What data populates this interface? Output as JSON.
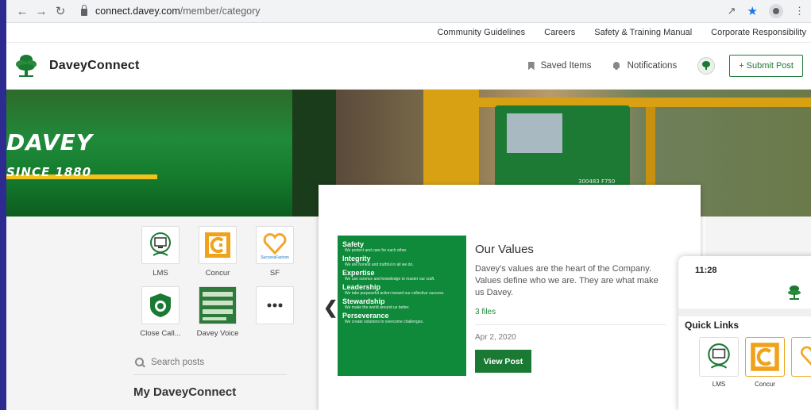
{
  "browser": {
    "url_host": "connect.davey.com",
    "url_path": "/member/category"
  },
  "utility_links": [
    "Community Guidelines",
    "Careers",
    "Safety & Training Manual",
    "Corporate Responsibility"
  ],
  "header": {
    "site_name": "DaveyConnect",
    "saved_items": "Saved Items",
    "notifications": "Notifications",
    "submit_post": "+ Submit Post"
  },
  "hero": {
    "brand": "DAVEY",
    "since": "SINCE 1880",
    "truck_tag": "300483 F750"
  },
  "apps": [
    {
      "label": "LMS",
      "icon": "lms-icon"
    },
    {
      "label": "Concur",
      "icon": "concur-icon"
    },
    {
      "label": "SF",
      "icon": "successfactors-icon"
    },
    {
      "label": "Close Call...",
      "icon": "close-call-icon"
    },
    {
      "label": "Davey Voice",
      "icon": "davey-voice-icon"
    },
    {
      "label": "",
      "icon": "more-icon"
    }
  ],
  "search": {
    "placeholder": "Search posts"
  },
  "my_section_title": "My DaveyConnect",
  "values_image": [
    {
      "head": "Safety",
      "sub": "We protect and care for each other."
    },
    {
      "head": "Integrity",
      "sub": "We are honest and truthful in all we do."
    },
    {
      "head": "Expertise",
      "sub": "We use science and knowledge to master our craft."
    },
    {
      "head": "Leadership",
      "sub": "We take purposeful action toward our collective success."
    },
    {
      "head": "Stewardship",
      "sub": "We make the world around us better."
    },
    {
      "head": "Perseverance",
      "sub": "We create solutions to overcome challenges."
    }
  ],
  "post": {
    "title": "Our Values",
    "description": "Davey's values are the heart of the Company. Values define who we are. They are what make us Davey.",
    "files": "3 files",
    "date": "Apr 2, 2020",
    "view_button": "View Post"
  },
  "phone": {
    "time": "11:28",
    "quick_links_title": "Quick Links",
    "apps": [
      "LMS",
      "Concur"
    ]
  },
  "colors": {
    "brand_green": "#1a7a34",
    "concur_orange": "#f0a21b",
    "sf_orange": "#f4a62a"
  }
}
